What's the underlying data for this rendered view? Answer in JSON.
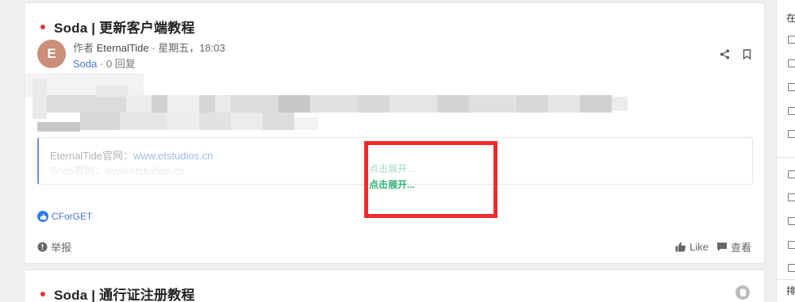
{
  "posts": [
    {
      "title": "Soda | 更新客户端教程",
      "avatar_text": "E",
      "author_prefix": "作者",
      "author": "EternalTide",
      "separator": "·",
      "time": "星期五，18:03",
      "category": "Soda",
      "replies": "0 回复",
      "quote": {
        "line1_label": "EternalTide官网：",
        "line1_link": "www.etstudios.cn",
        "line2": "Soda官网：www.etstudios.cn"
      },
      "expand_ghost": "点击展开...",
      "expand": "点击展开...",
      "liked_by": "CForGET",
      "report": "举报",
      "like": "Like",
      "view": "查看"
    },
    {
      "title": "Soda | 通行证注册教程"
    }
  ],
  "sidebar": {
    "heading": "在",
    "footer": "排"
  },
  "colors": {
    "accent_red": "#e3342f",
    "link_blue": "#4a73d3",
    "expand_green": "#2fb37a",
    "highlight_red": "#ef2b2b"
  },
  "icons": [
    "share-icon",
    "bookmark-icon",
    "report-icon",
    "thumbs-up-icon",
    "comment-icon",
    "like-badge-icon",
    "pin-icon"
  ]
}
